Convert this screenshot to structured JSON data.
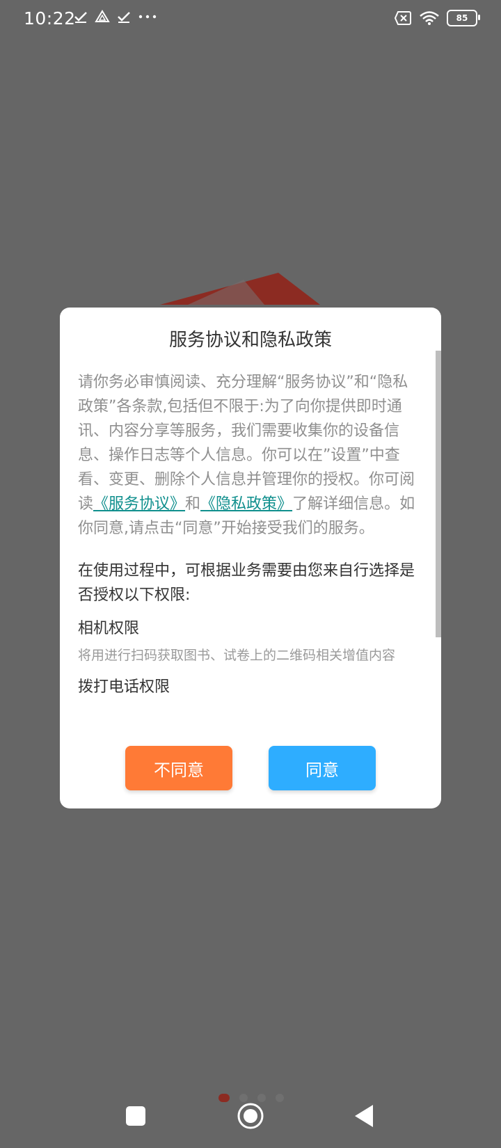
{
  "status_bar": {
    "time": "10:22",
    "battery": "85"
  },
  "dialog": {
    "title": "服务协议和隐私政策",
    "intro": {
      "part1": "请你务必审慎阅读、充分理解“服务协议”和“隐私政策”各条款,包括但不限于:为了向你提供即时通讯、内容分享等服务，我们需要收集你的设备信息、操作日志等个人信息。你可以在”设置”中查看、变更、删除个人信息并管理你的授权。你可阅读",
      "link_service": "《服务协议》",
      "and": "和",
      "link_privacy": "《隐私政策》",
      "part2": "了解详细信息。如你同意,请点击“同意”开始接受我们的服务。"
    },
    "permissions_heading": "在使用过程中，可根据业务需要由您来自行选择是否授权以下权限:",
    "permissions": [
      {
        "title": "相机权限",
        "desc": "将用进行扫码获取图书、试卷上的二维码相关增值内容"
      },
      {
        "title": "拨打电话权限",
        "desc": ""
      }
    ],
    "buttons": {
      "disagree": "不同意",
      "agree": "同意"
    }
  },
  "colors": {
    "overlay": "#666666",
    "disagree": "#ff7a36",
    "agree": "#2eadff",
    "link": "#0f8f8d"
  }
}
